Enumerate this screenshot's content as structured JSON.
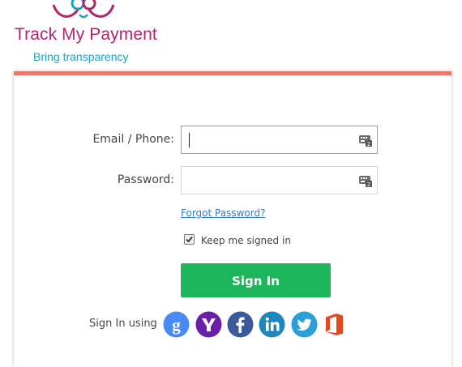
{
  "brand": {
    "name": "Track My Payment",
    "tagline": "Bring transparency",
    "colors": {
      "name": "#b3246e",
      "tagline": "#1ba3c6",
      "card_accent": "#e9776a"
    }
  },
  "login_form": {
    "email": {
      "label": "Email / Phone:",
      "value": "",
      "placeholder": "",
      "trailing_icon": "keyboard-icon"
    },
    "password": {
      "label": "Password:",
      "value": "",
      "placeholder": "",
      "trailing_icon": "keyboard-icon"
    },
    "forgot_password_link": "Forgot Password?",
    "keep_signed_in": {
      "label": "Keep me signed in",
      "checked": true
    },
    "sign_in_button": {
      "label": "Sign In",
      "color": "#1db65a"
    }
  },
  "social_login": {
    "label": "Sign In using",
    "providers": [
      {
        "name": "google-icon",
        "color": "#4a8af4"
      },
      {
        "name": "yahoo-icon",
        "color": "#6a1fa8"
      },
      {
        "name": "facebook-icon",
        "color": "#3b5a9a"
      },
      {
        "name": "linkedin-icon",
        "color": "#1d87bd"
      },
      {
        "name": "twitter-icon",
        "color": "#2ba0d8"
      },
      {
        "name": "office-icon",
        "color": "#e24a1d"
      }
    ]
  }
}
